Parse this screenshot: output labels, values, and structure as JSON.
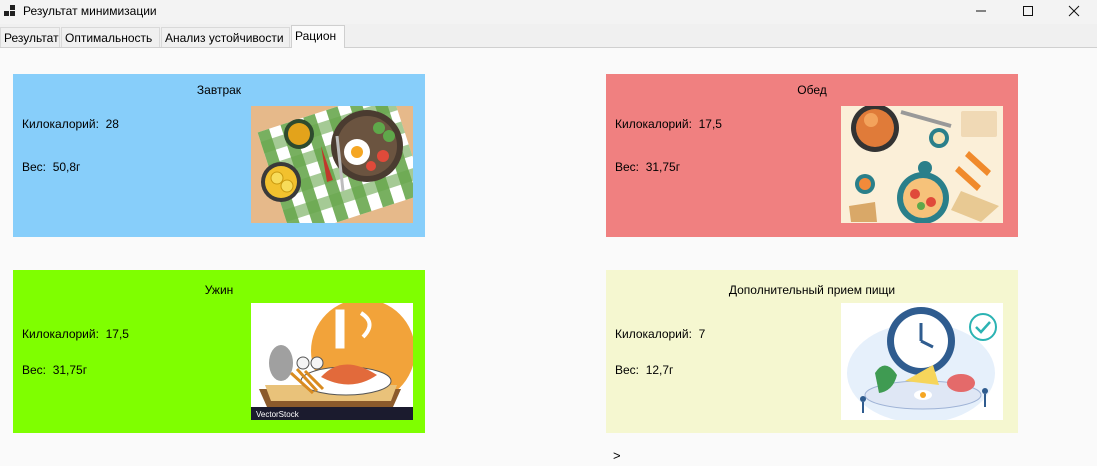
{
  "window": {
    "title": "Результат минимизации"
  },
  "tabs": [
    {
      "label": "Результат"
    },
    {
      "label": "Оптимальность"
    },
    {
      "label": "Анализ устойчивости"
    },
    {
      "label": "Рацион",
      "active": true
    }
  ],
  "meals": [
    {
      "title": "Завтрак",
      "kcal_label": "Килокалорий:",
      "kcal": "28",
      "weight_label": "Вес:",
      "weight": "50,8г",
      "color": "#87cefa"
    },
    {
      "title": "Обед",
      "kcal_label": "Килокалорий:",
      "kcal": "17,5",
      "weight_label": "Вес:",
      "weight": "31,75г",
      "color": "#f08080"
    },
    {
      "title": "Ужин",
      "kcal_label": "Килокалорий:",
      "kcal": "17,5",
      "weight_label": "Вес:",
      "weight": "31,75г",
      "color": "#7fff00"
    },
    {
      "title": "Дополнительный прием пищи",
      "kcal_label": "Килокалорий:",
      "kcal": "7",
      "weight_label": "Вес:",
      "weight": "12,7г",
      "color": "#f5f7d0"
    }
  ],
  "dinner_image_watermark": "VectorStock",
  "prompt_symbol": ">",
  "icons": {
    "app": "app-icon",
    "minimize": "minimize-icon",
    "maximize": "maximize-icon",
    "close": "close-icon"
  }
}
